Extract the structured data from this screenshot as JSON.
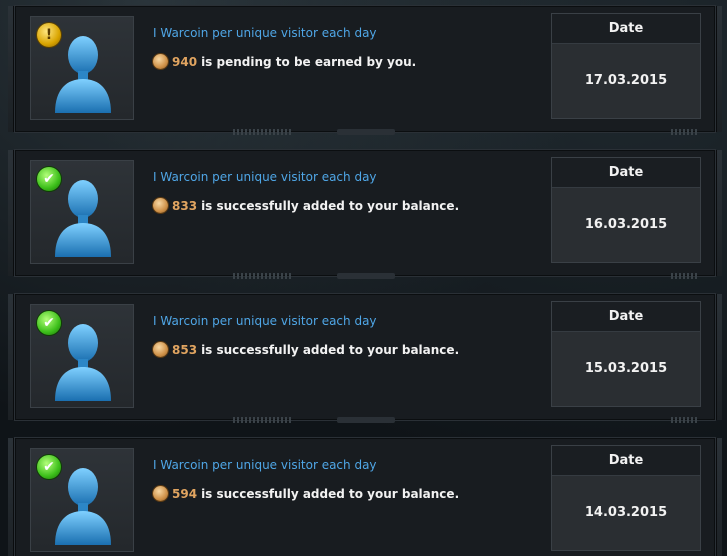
{
  "entries": [
    {
      "status": "pending",
      "status_icon": "warning-icon",
      "status_glyph": "!",
      "title": "I Warcoin per unique visitor each day",
      "amount": "940",
      "message": "is pending to be earned by you.",
      "date_label": "Date",
      "date": "17.03.2015"
    },
    {
      "status": "success",
      "status_icon": "checkmark-icon",
      "status_glyph": "✔",
      "title": "I Warcoin per unique visitor each day",
      "amount": "833",
      "message": "is successfully added to your balance.",
      "date_label": "Date",
      "date": "16.03.2015"
    },
    {
      "status": "success",
      "status_icon": "checkmark-icon",
      "status_glyph": "✔",
      "title": "I Warcoin per unique visitor each day",
      "amount": "853",
      "message": "is successfully added to your balance.",
      "date_label": "Date",
      "date": "15.03.2015"
    },
    {
      "status": "success",
      "status_icon": "checkmark-icon",
      "status_glyph": "✔",
      "title": "I Warcoin per unique visitor each day",
      "amount": "594",
      "message": "is successfully added to your balance.",
      "date_label": "Date",
      "date": "14.03.2015"
    }
  ],
  "colors": {
    "title": "#4fa6e6",
    "amount": "#e0a460",
    "text": "#f2f2f2",
    "pending": "#d9a400",
    "success": "#3cbf1a"
  }
}
